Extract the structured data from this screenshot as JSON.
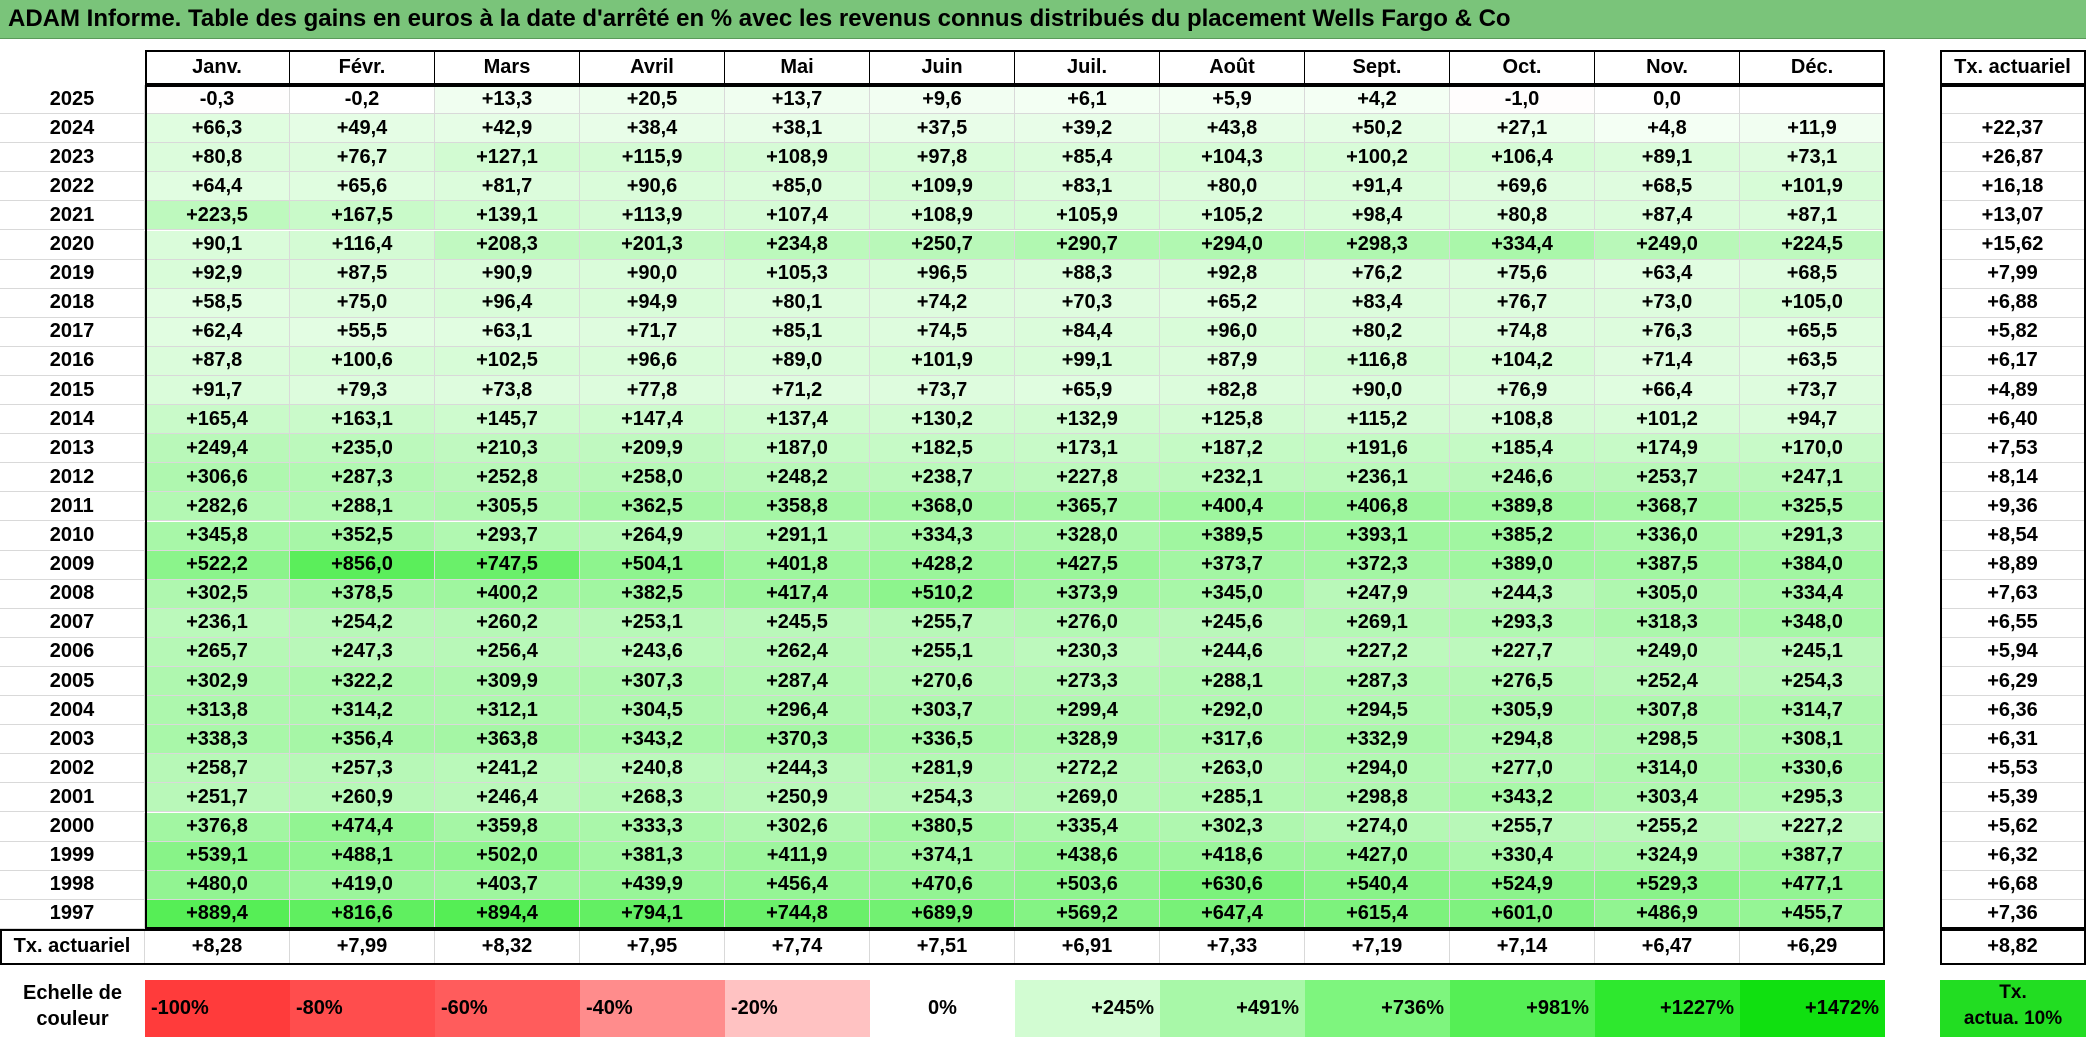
{
  "title": "ADAM Informe. Table des gains en euros à la date d'arrêté en % avec les revenus connus distribués du placement Wells Fargo & Co",
  "months": [
    "Janv.",
    "Févr.",
    "Mars",
    "Avril",
    "Mai",
    "Juin",
    "Juil.",
    "Août",
    "Sept.",
    "Oct.",
    "Nov.",
    "Déc."
  ],
  "rate_header": "Tx. actuariel",
  "rows": [
    {
      "year": "2025",
      "values": [
        "-0,3",
        "-0,2",
        "+13,3",
        "+20,5",
        "+13,7",
        "+9,6",
        "+6,1",
        "+5,9",
        "+4,2",
        "-1,0",
        "0,0",
        ""
      ],
      "rate": ""
    },
    {
      "year": "2024",
      "values": [
        "+66,3",
        "+49,4",
        "+42,9",
        "+38,4",
        "+38,1",
        "+37,5",
        "+39,2",
        "+43,8",
        "+50,2",
        "+27,1",
        "+4,8",
        "+11,9"
      ],
      "rate": "+22,37"
    },
    {
      "year": "2023",
      "values": [
        "+80,8",
        "+76,7",
        "+127,1",
        "+115,9",
        "+108,9",
        "+97,8",
        "+85,4",
        "+104,3",
        "+100,2",
        "+106,4",
        "+89,1",
        "+73,1"
      ],
      "rate": "+26,87"
    },
    {
      "year": "2022",
      "values": [
        "+64,4",
        "+65,6",
        "+81,7",
        "+90,6",
        "+85,0",
        "+109,9",
        "+83,1",
        "+80,0",
        "+91,4",
        "+69,6",
        "+68,5",
        "+101,9"
      ],
      "rate": "+16,18"
    },
    {
      "year": "2021",
      "values": [
        "+223,5",
        "+167,5",
        "+139,1",
        "+113,9",
        "+107,4",
        "+108,9",
        "+105,9",
        "+105,2",
        "+98,4",
        "+80,8",
        "+87,4",
        "+87,1"
      ],
      "rate": "+13,07"
    },
    {
      "year": "2020",
      "values": [
        "+90,1",
        "+116,4",
        "+208,3",
        "+201,3",
        "+234,8",
        "+250,7",
        "+290,7",
        "+294,0",
        "+298,3",
        "+334,4",
        "+249,0",
        "+224,5"
      ],
      "rate": "+15,62"
    },
    {
      "year": "2019",
      "values": [
        "+92,9",
        "+87,5",
        "+90,9",
        "+90,0",
        "+105,3",
        "+96,5",
        "+88,3",
        "+92,8",
        "+76,2",
        "+75,6",
        "+63,4",
        "+68,5"
      ],
      "rate": "+7,99"
    },
    {
      "year": "2018",
      "values": [
        "+58,5",
        "+75,0",
        "+96,4",
        "+94,9",
        "+80,1",
        "+74,2",
        "+70,3",
        "+65,2",
        "+83,4",
        "+76,7",
        "+73,0",
        "+105,0"
      ],
      "rate": "+6,88"
    },
    {
      "year": "2017",
      "values": [
        "+62,4",
        "+55,5",
        "+63,1",
        "+71,7",
        "+85,1",
        "+74,5",
        "+84,4",
        "+96,0",
        "+80,2",
        "+74,8",
        "+76,3",
        "+65,5"
      ],
      "rate": "+5,82"
    },
    {
      "year": "2016",
      "values": [
        "+87,8",
        "+100,6",
        "+102,5",
        "+96,6",
        "+89,0",
        "+101,9",
        "+99,1",
        "+87,9",
        "+116,8",
        "+104,2",
        "+71,4",
        "+63,5"
      ],
      "rate": "+6,17"
    },
    {
      "year": "2015",
      "values": [
        "+91,7",
        "+79,3",
        "+73,8",
        "+77,8",
        "+71,2",
        "+73,7",
        "+65,9",
        "+82,8",
        "+90,0",
        "+76,9",
        "+66,4",
        "+73,7"
      ],
      "rate": "+4,89"
    },
    {
      "year": "2014",
      "values": [
        "+165,4",
        "+163,1",
        "+145,7",
        "+147,4",
        "+137,4",
        "+130,2",
        "+132,9",
        "+125,8",
        "+115,2",
        "+108,8",
        "+101,2",
        "+94,7"
      ],
      "rate": "+6,40"
    },
    {
      "year": "2013",
      "values": [
        "+249,4",
        "+235,0",
        "+210,3",
        "+209,9",
        "+187,0",
        "+182,5",
        "+173,1",
        "+187,2",
        "+191,6",
        "+185,4",
        "+174,9",
        "+170,0"
      ],
      "rate": "+7,53"
    },
    {
      "year": "2012",
      "values": [
        "+306,6",
        "+287,3",
        "+252,8",
        "+258,0",
        "+248,2",
        "+238,7",
        "+227,8",
        "+232,1",
        "+236,1",
        "+246,6",
        "+253,7",
        "+247,1"
      ],
      "rate": "+8,14"
    },
    {
      "year": "2011",
      "values": [
        "+282,6",
        "+288,1",
        "+305,5",
        "+362,5",
        "+358,8",
        "+368,0",
        "+365,7",
        "+400,4",
        "+406,8",
        "+389,8",
        "+368,7",
        "+325,5"
      ],
      "rate": "+9,36"
    },
    {
      "year": "2010",
      "values": [
        "+345,8",
        "+352,5",
        "+293,7",
        "+264,9",
        "+291,1",
        "+334,3",
        "+328,0",
        "+389,5",
        "+393,1",
        "+385,2",
        "+336,0",
        "+291,3"
      ],
      "rate": "+8,54"
    },
    {
      "year": "2009",
      "values": [
        "+522,2",
        "+856,0",
        "+747,5",
        "+504,1",
        "+401,8",
        "+428,2",
        "+427,5",
        "+373,7",
        "+372,3",
        "+389,0",
        "+387,5",
        "+384,0"
      ],
      "rate": "+8,89"
    },
    {
      "year": "2008",
      "values": [
        "+302,5",
        "+378,5",
        "+400,2",
        "+382,5",
        "+417,4",
        "+510,2",
        "+373,9",
        "+345,0",
        "+247,9",
        "+244,3",
        "+305,0",
        "+334,4"
      ],
      "rate": "+7,63"
    },
    {
      "year": "2007",
      "values": [
        "+236,1",
        "+254,2",
        "+260,2",
        "+253,1",
        "+245,5",
        "+255,7",
        "+276,0",
        "+245,6",
        "+269,1",
        "+293,3",
        "+318,3",
        "+348,0"
      ],
      "rate": "+6,55"
    },
    {
      "year": "2006",
      "values": [
        "+265,7",
        "+247,3",
        "+256,4",
        "+243,6",
        "+262,4",
        "+255,1",
        "+230,3",
        "+244,6",
        "+227,2",
        "+227,7",
        "+249,0",
        "+245,1"
      ],
      "rate": "+5,94"
    },
    {
      "year": "2005",
      "values": [
        "+302,9",
        "+322,2",
        "+309,9",
        "+307,3",
        "+287,4",
        "+270,6",
        "+273,3",
        "+288,1",
        "+287,3",
        "+276,5",
        "+252,4",
        "+254,3"
      ],
      "rate": "+6,29"
    },
    {
      "year": "2004",
      "values": [
        "+313,8",
        "+314,2",
        "+312,1",
        "+304,5",
        "+296,4",
        "+303,7",
        "+299,4",
        "+292,0",
        "+294,5",
        "+305,9",
        "+307,8",
        "+314,7"
      ],
      "rate": "+6,36"
    },
    {
      "year": "2003",
      "values": [
        "+338,3",
        "+356,4",
        "+363,8",
        "+343,2",
        "+370,3",
        "+336,5",
        "+328,9",
        "+317,6",
        "+332,9",
        "+294,8",
        "+298,5",
        "+308,1"
      ],
      "rate": "+6,31"
    },
    {
      "year": "2002",
      "values": [
        "+258,7",
        "+257,3",
        "+241,2",
        "+240,8",
        "+244,3",
        "+281,9",
        "+272,2",
        "+263,0",
        "+294,0",
        "+277,0",
        "+314,0",
        "+330,6"
      ],
      "rate": "+5,53"
    },
    {
      "year": "2001",
      "values": [
        "+251,7",
        "+260,9",
        "+246,4",
        "+268,3",
        "+250,9",
        "+254,3",
        "+269,0",
        "+285,1",
        "+298,8",
        "+343,2",
        "+303,4",
        "+295,3"
      ],
      "rate": "+5,39"
    },
    {
      "year": "2000",
      "values": [
        "+376,8",
        "+474,4",
        "+359,8",
        "+333,3",
        "+302,6",
        "+380,5",
        "+335,4",
        "+302,3",
        "+274,0",
        "+255,7",
        "+255,2",
        "+227,2"
      ],
      "rate": "+5,62"
    },
    {
      "year": "1999",
      "values": [
        "+539,1",
        "+488,1",
        "+502,0",
        "+381,3",
        "+411,9",
        "+374,1",
        "+438,6",
        "+418,6",
        "+427,0",
        "+330,4",
        "+324,9",
        "+387,7"
      ],
      "rate": "+6,32"
    },
    {
      "year": "1998",
      "values": [
        "+480,0",
        "+419,0",
        "+403,7",
        "+439,9",
        "+456,4",
        "+470,6",
        "+503,6",
        "+630,6",
        "+540,4",
        "+524,9",
        "+529,3",
        "+477,1"
      ],
      "rate": "+6,68"
    },
    {
      "year": "1997",
      "values": [
        "+889,4",
        "+816,6",
        "+894,4",
        "+794,1",
        "+744,8",
        "+689,9",
        "+569,2",
        "+647,4",
        "+615,4",
        "+601,0",
        "+486,9",
        "+455,7"
      ],
      "rate": "+7,36"
    }
  ],
  "footer": {
    "label": "Tx. actuariel",
    "values": [
      "+8,28",
      "+7,99",
      "+8,32",
      "+7,95",
      "+7,74",
      "+7,51",
      "+6,91",
      "+7,33",
      "+7,19",
      "+7,14",
      "+6,47",
      "+6,29"
    ],
    "rate": "+8,82"
  },
  "scale": {
    "label_line1": "Echelle de",
    "label_line2": "couleur",
    "items": [
      {
        "text": "-100%",
        "color": "#ff3b3b",
        "align": "left"
      },
      {
        "text": "-80%",
        "color": "#ff4d4d",
        "align": "left"
      },
      {
        "text": "-60%",
        "color": "#ff5c5c",
        "align": "left"
      },
      {
        "text": "-40%",
        "color": "#ff8c8c",
        "align": "left"
      },
      {
        "text": "-20%",
        "color": "#ffc2c2",
        "align": "left"
      },
      {
        "text": "0%",
        "color": "#ffffff",
        "align": "center"
      },
      {
        "text": "+245%",
        "color": "#d2fcd2",
        "align": "right"
      },
      {
        "text": "+491%",
        "color": "#a8f8a8",
        "align": "right"
      },
      {
        "text": "+736%",
        "color": "#7ef57e",
        "align": "right"
      },
      {
        "text": "+981%",
        "color": "#55ef55",
        "align": "right"
      },
      {
        "text": "+1227%",
        "color": "#2ee82e",
        "align": "right"
      },
      {
        "text": "+1472%",
        "color": "#10e010",
        "align": "right"
      }
    ],
    "tx_line1": "Tx.",
    "tx_line2": "actua. 10%"
  },
  "colors": {
    "title_bg": "#7ac47a",
    "max_green": "#10e010",
    "tx_actua_bg": "#22dd22"
  }
}
